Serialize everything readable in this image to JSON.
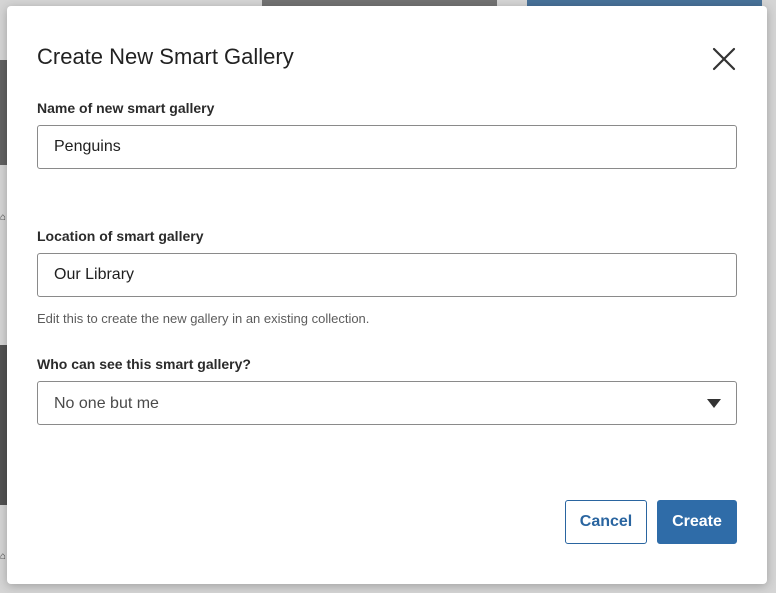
{
  "dialog": {
    "title": "Create New Smart Gallery",
    "close_icon": "close-icon"
  },
  "name_field": {
    "label": "Name of new smart gallery",
    "value": "Penguins"
  },
  "location_field": {
    "label": "Location of smart gallery",
    "value": "Our Library",
    "help": "Edit this to create the new gallery in an existing collection."
  },
  "visibility_field": {
    "label": "Who can see this smart gallery?",
    "selected": "No one but me",
    "arrow_icon": "caret-down-icon"
  },
  "buttons": {
    "cancel": "Cancel",
    "create": "Create"
  },
  "colors": {
    "accent": "#2f6ca8",
    "text": "#222222"
  }
}
